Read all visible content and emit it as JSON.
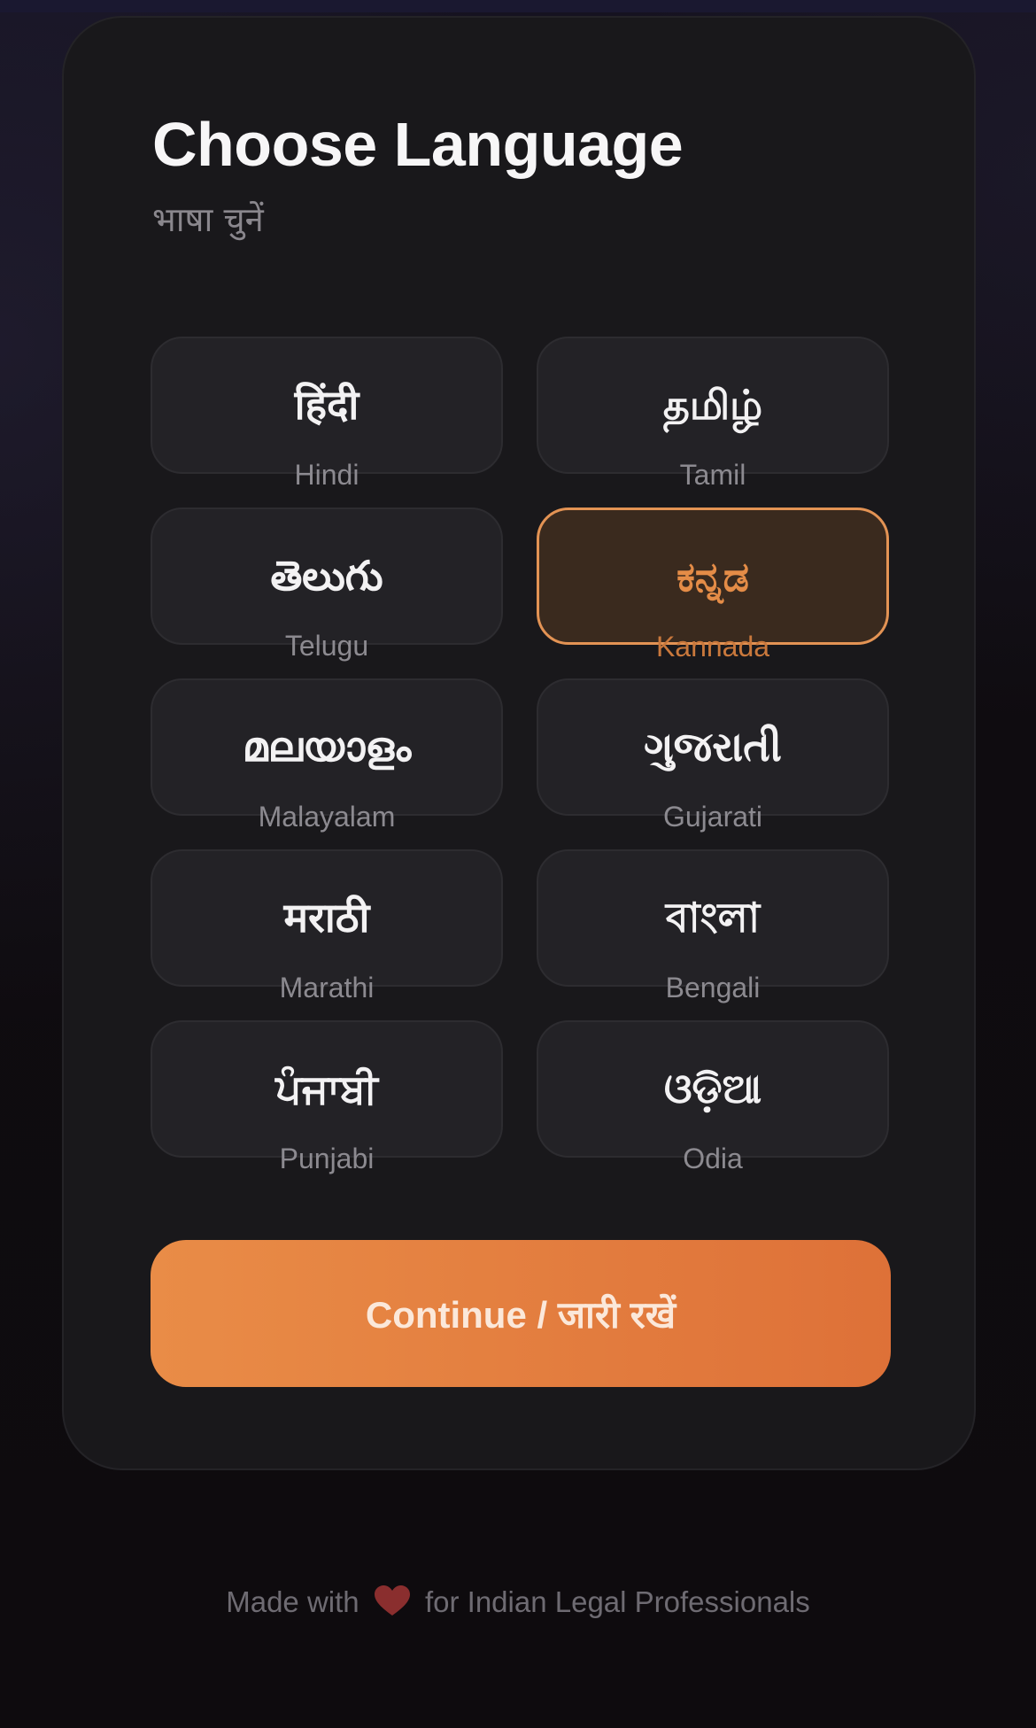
{
  "header": {
    "title": "Choose Language",
    "subtitle": "भाषा चुनें"
  },
  "languages": [
    {
      "native": "हिंदी",
      "english": "Hindi",
      "selected": false
    },
    {
      "native": "தமிழ்",
      "english": "Tamil",
      "selected": false
    },
    {
      "native": "తెలుగు",
      "english": "Telugu",
      "selected": false
    },
    {
      "native": "ಕನ್ನಡ",
      "english": "Kannada",
      "selected": true
    },
    {
      "native": "മലയാളം",
      "english": "Malayalam",
      "selected": false
    },
    {
      "native": "ગુજરાતી",
      "english": "Gujarati",
      "selected": false
    },
    {
      "native": "मराठी",
      "english": "Marathi",
      "selected": false
    },
    {
      "native": "বাংলা",
      "english": "Bengali",
      "selected": false
    },
    {
      "native": "ਪੰਜਾਬੀ",
      "english": "Punjabi",
      "selected": false
    },
    {
      "native": "ଓଡ଼ିଆ",
      "english": "Odia",
      "selected": false
    }
  ],
  "continue_label": "Continue / जारी रखें",
  "footer": {
    "prefix": "Made with",
    "icon": "heart-icon",
    "suffix": "for Indian Legal Professionals"
  },
  "colors": {
    "accent": "#e98c47",
    "selected_border": "#e39354",
    "heart": "#8a2e2e"
  }
}
